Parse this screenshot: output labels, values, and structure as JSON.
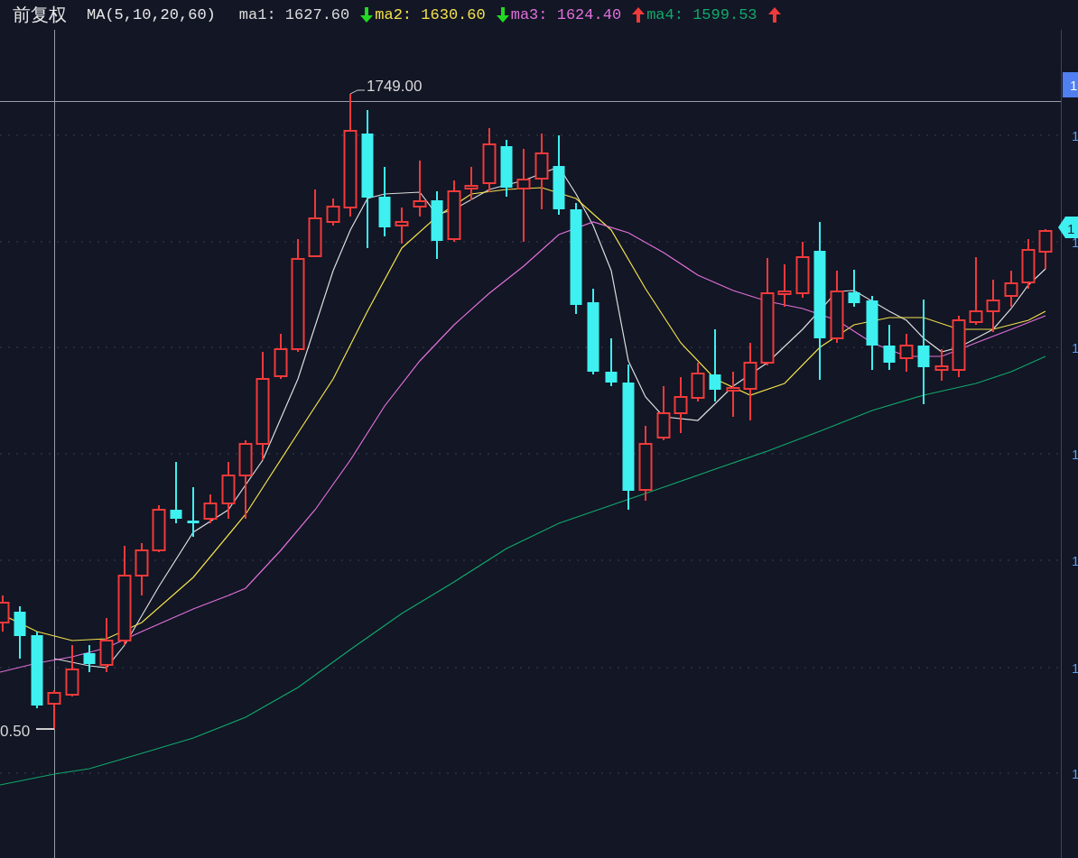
{
  "header": {
    "title": "前复权",
    "indicator": "MA(5,10,20,60)",
    "ma_values": [
      {
        "label": "ma1:",
        "value": "1627.60",
        "rising": false,
        "color": "#dcdcdc"
      },
      {
        "label": "ma2:",
        "value": "1630.60",
        "rising": false,
        "color": "#f2e04c"
      },
      {
        "label": "ma3:",
        "value": "1624.40",
        "rising": true,
        "color": "#e070d8"
      },
      {
        "label": "ma4:",
        "value": "1599.53",
        "rising": true,
        "color": "#12a86a"
      }
    ]
  },
  "chart": {
    "high_label": "1749.00",
    "low_label": "0.50",
    "crosshair_tag": "1",
    "price_tag": "1",
    "axis_labels": [
      "1",
      "1",
      "1",
      "1",
      "1",
      "1",
      "1"
    ]
  }
}
